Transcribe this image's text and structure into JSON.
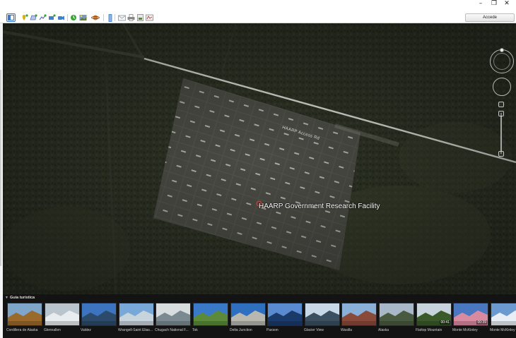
{
  "window": {
    "controls": [
      "–",
      "❐",
      "✕"
    ]
  },
  "toolbar": {
    "buttons": [
      {
        "name": "sidebar-toggle-icon",
        "color": "#3c78c8"
      },
      {
        "name": "add-placemark-icon",
        "color": "#d0b21a"
      },
      {
        "name": "add-polygon-icon",
        "color": "#7a8fc7"
      },
      {
        "name": "add-path-icon",
        "color": "#7a8fc7"
      },
      {
        "name": "add-overlay-icon",
        "color": "#3f7fd0"
      },
      {
        "name": "record-tour-icon",
        "color": "#3f7fd0"
      },
      {
        "name": "historical-imagery-icon",
        "color": "#3aa13a"
      },
      {
        "name": "sunlight-icon",
        "color": "#6a7a3a"
      },
      {
        "name": "planets-icon",
        "color": "#d07a30"
      },
      {
        "name": "ruler-icon",
        "color": "#5a8fd0"
      },
      {
        "name": "email-icon",
        "color": "#9aa4b0"
      },
      {
        "name": "print-icon",
        "color": "#8a8a8a"
      },
      {
        "name": "save-image-icon",
        "color": "#8a8a8a"
      },
      {
        "name": "view-in-maps-icon",
        "color": "#8a8a8a"
      }
    ],
    "signin_label": "Accede"
  },
  "map": {
    "road_label": "HAARP Access Rd",
    "place_label": "HAARP Government Research Facility",
    "pin_color": "#e03030"
  },
  "tour_guide": {
    "title": "Guía turística",
    "items": [
      {
        "label": "Cordillera de Alaska",
        "sky": "#7fa6c9",
        "ground": "#9a6a2c",
        "duration": ""
      },
      {
        "label": "Glennallen",
        "sky": "#b9c4cc",
        "ground": "#e8ecef",
        "duration": ""
      },
      {
        "label": "Valdez",
        "sky": "#3c74c0",
        "ground": "#2c4a6a",
        "duration": ""
      },
      {
        "label": "Wrangell-Saint Elias...",
        "sky": "#78a8d8",
        "ground": "#c8d4dc",
        "duration": ""
      },
      {
        "label": "Chugach National F...",
        "sky": "#d8dde0",
        "ground": "#7a8a90",
        "duration": ""
      },
      {
        "label": "Tok",
        "sky": "#3a78c8",
        "ground": "#5a8a3a",
        "duration": ""
      },
      {
        "label": "Delta Junction",
        "sky": "#2f6fc0",
        "ground": "#b8b8b0",
        "duration": ""
      },
      {
        "label": "Paxson",
        "sky": "#5a8ad0",
        "ground": "#1a3a6a",
        "duration": ""
      },
      {
        "label": "Glacier View",
        "sky": "#c8d8e8",
        "ground": "#3a5060",
        "duration": ""
      },
      {
        "label": "Wasilla",
        "sky": "#8ab0d8",
        "ground": "#8a4a3a",
        "duration": ""
      },
      {
        "label": "Alaska",
        "sky": "#a8b8c8",
        "ground": "#4a5a40",
        "duration": ""
      },
      {
        "label": "Flattop Mountain",
        "sky": "#c8d4dc",
        "ground": "#3a5a2a",
        "duration": "00:41"
      },
      {
        "label": "Monte McKinley",
        "sky": "#4a78c0",
        "ground": "#d88aa0",
        "duration": "00:39"
      },
      {
        "label": "Monte McKinley",
        "sky": "#6a9ad0",
        "ground": "#e8eef4",
        "duration": ""
      }
    ]
  }
}
